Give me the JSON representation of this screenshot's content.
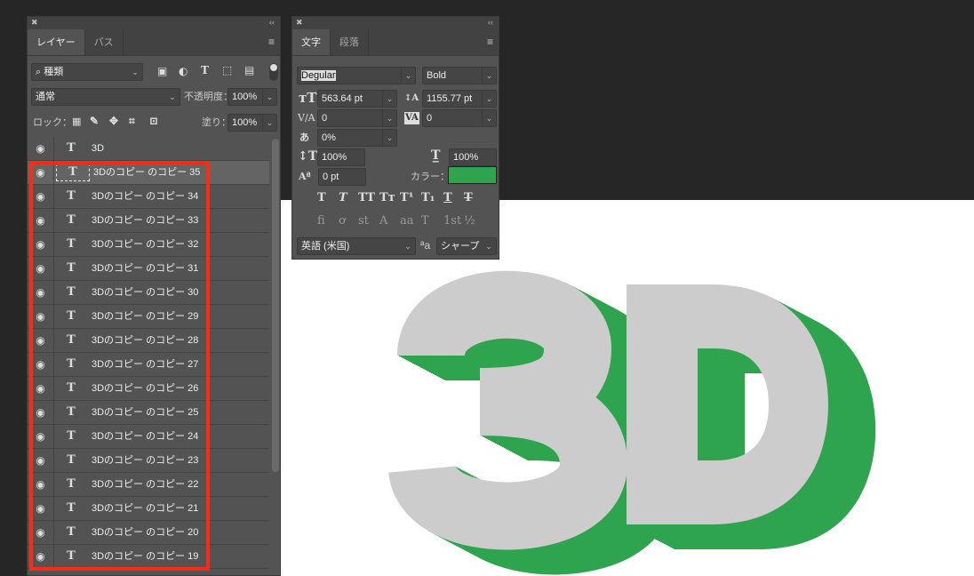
{
  "layers_panel": {
    "tabs": [
      "レイヤー",
      "パス"
    ],
    "filter": "種類",
    "blend_mode": "通常",
    "opacity_label": "不透明度：",
    "opacity": "100%",
    "lock_label": "ロック：",
    "fill_label": "塗り：",
    "fill": "100%",
    "layers": [
      "3D",
      "3Dのコピー のコピー 35",
      "3Dのコピー のコピー 34",
      "3Dのコピー のコピー 33",
      "3Dのコピー のコピー 32",
      "3Dのコピー のコピー 31",
      "3Dのコピー のコピー 30",
      "3Dのコピー のコピー 29",
      "3Dのコピー のコピー 28",
      "3Dのコピー のコピー 27",
      "3Dのコピー のコピー 26",
      "3Dのコピー のコピー 25",
      "3Dのコピー のコピー 24",
      "3Dのコピー のコピー 23",
      "3Dのコピー のコピー 22",
      "3Dのコピー のコピー 21",
      "3Dのコピー のコピー 20",
      "3Dのコピー のコピー 19"
    ]
  },
  "character_panel": {
    "tabs": [
      "文字",
      "段落"
    ],
    "font_family": "Degular",
    "font_style": "Bold",
    "font_size": "563.64 pt",
    "leading": "1155.77 pt",
    "kerning": "0",
    "tracking": "0",
    "tsume": "0%",
    "vertical_scale": "100%",
    "horizontal_scale": "100%",
    "baseline_shift": "0 pt",
    "color_label": "カラー：",
    "color": "#2ea44f",
    "language": "英語 (米国)",
    "antialias": "シャープ",
    "style_buttons": [
      "T",
      "T",
      "TT",
      "Tт",
      "T¹",
      "T₁",
      "T",
      "T"
    ],
    "opentype_buttons": [
      "ﬁ",
      "ơ",
      "st",
      "A",
      "aa",
      "T",
      "1st",
      "½"
    ]
  },
  "canvas": {
    "text": "3D",
    "fill": "#cccccc",
    "extrude_color": "#2ea44f"
  }
}
